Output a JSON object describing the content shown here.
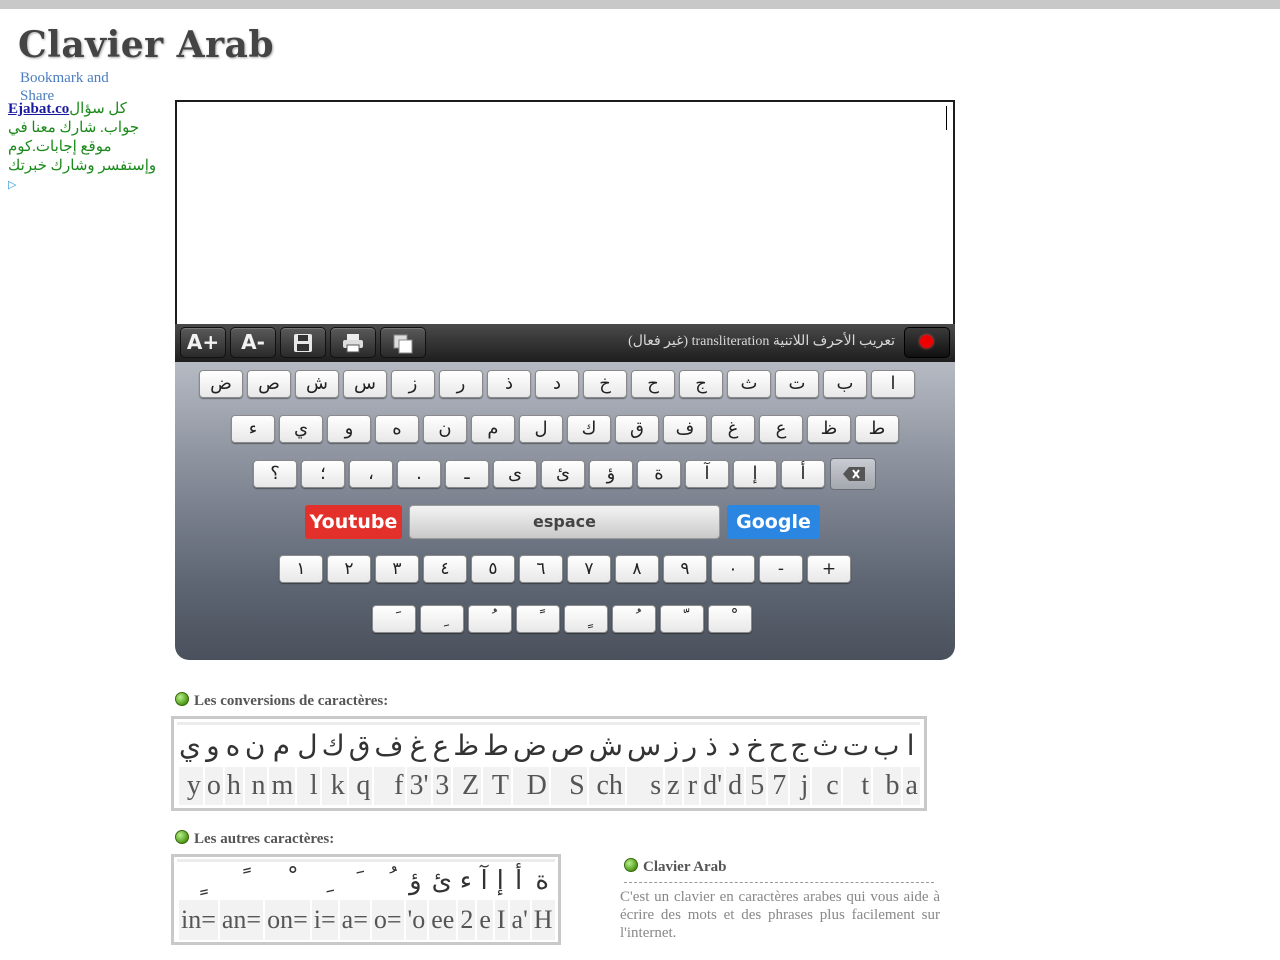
{
  "page": {
    "title": "Clavier Arab",
    "bookmark_alt": "Bookmark and Share"
  },
  "ad": {
    "link": "Ejabat.co",
    "text": "كل سؤال جواب. شارك معنا في موقع إجابات.كوم وإستفسر وشارك خبرتك",
    "icon": "adchoices-icon"
  },
  "editor": {
    "value": ""
  },
  "toolbar": {
    "font_increase": "A+",
    "font_decrease": "A-",
    "save_icon": "floppy-disk-icon",
    "print_icon": "printer-icon",
    "copy_icon": "copy-icon",
    "transliteration_label": "تعريب الأحرف اللاتنية transliteration (غير فعال)",
    "record_icon": "record-dot-icon"
  },
  "keyboard": {
    "row1": [
      "ا",
      "ب",
      "ت",
      "ث",
      "ج",
      "ح",
      "خ",
      "د",
      "ذ",
      "ر",
      "ز",
      "س",
      "ش",
      "ص",
      "ض"
    ],
    "row2": [
      "ط",
      "ظ",
      "ع",
      "غ",
      "ف",
      "ق",
      "ك",
      "ل",
      "م",
      "ن",
      "ه",
      "و",
      "ي",
      "ء"
    ],
    "row3": [
      "أ",
      "إ",
      "آ",
      "ة",
      "ؤ",
      "ئ",
      "ى",
      "ـ",
      ".",
      "،",
      "؛",
      "؟"
    ],
    "backspace_icon": "backspace-icon",
    "youtube_label": "Youtube",
    "space_label": "espace",
    "google_label": "Google",
    "digits": [
      "+",
      "-",
      "٠",
      "٩",
      "٨",
      "٧",
      "٦",
      "٥",
      "٤",
      "٣",
      "٢",
      "١"
    ],
    "diacritics": [
      "ْ",
      "ّ",
      "ُ",
      "ٍ",
      "ً",
      "ُ",
      "ِ",
      "َ"
    ]
  },
  "conversions": {
    "heading": "Les conversions de caractères:",
    "arabic": [
      "ا",
      "ب",
      "ت",
      "ث",
      "ج",
      "ح",
      "خ",
      "د",
      "ذ",
      "ر",
      "ز",
      "س",
      "ش",
      "ص",
      "ض",
      "ط",
      "ظ",
      "ع",
      "غ",
      "ف",
      "ق",
      "ك",
      "ل",
      "م",
      "ن",
      "ه",
      "و",
      "ي"
    ],
    "latin": [
      "a",
      "b",
      "t",
      "c",
      "j",
      "7",
      "5",
      "d",
      "d'",
      "r",
      "z",
      "s",
      "ch",
      "S",
      "D",
      "T",
      "Z",
      "3",
      "3'",
      "f",
      "q",
      "k",
      "l",
      "m",
      "n",
      "h",
      "o",
      "y"
    ]
  },
  "others": {
    "heading": "Les autres caractères:",
    "arabic": [
      "ة",
      "أ",
      "إ",
      "آ",
      "ء",
      "ئ",
      "ؤ",
      "ُ",
      "َ",
      "ِ",
      "ْ",
      "ً",
      "ٍ"
    ],
    "latin": [
      "H",
      "a'",
      "I",
      "e",
      "2",
      "ee",
      "'o",
      "o=",
      "a=",
      "i=",
      "on=",
      "an=",
      "in="
    ]
  },
  "info": {
    "title": "Clavier Arab",
    "text": "C'est un clavier en caractères arabes qui vous aide à écrire des mots et des phrases plus facilement sur l'internet."
  }
}
